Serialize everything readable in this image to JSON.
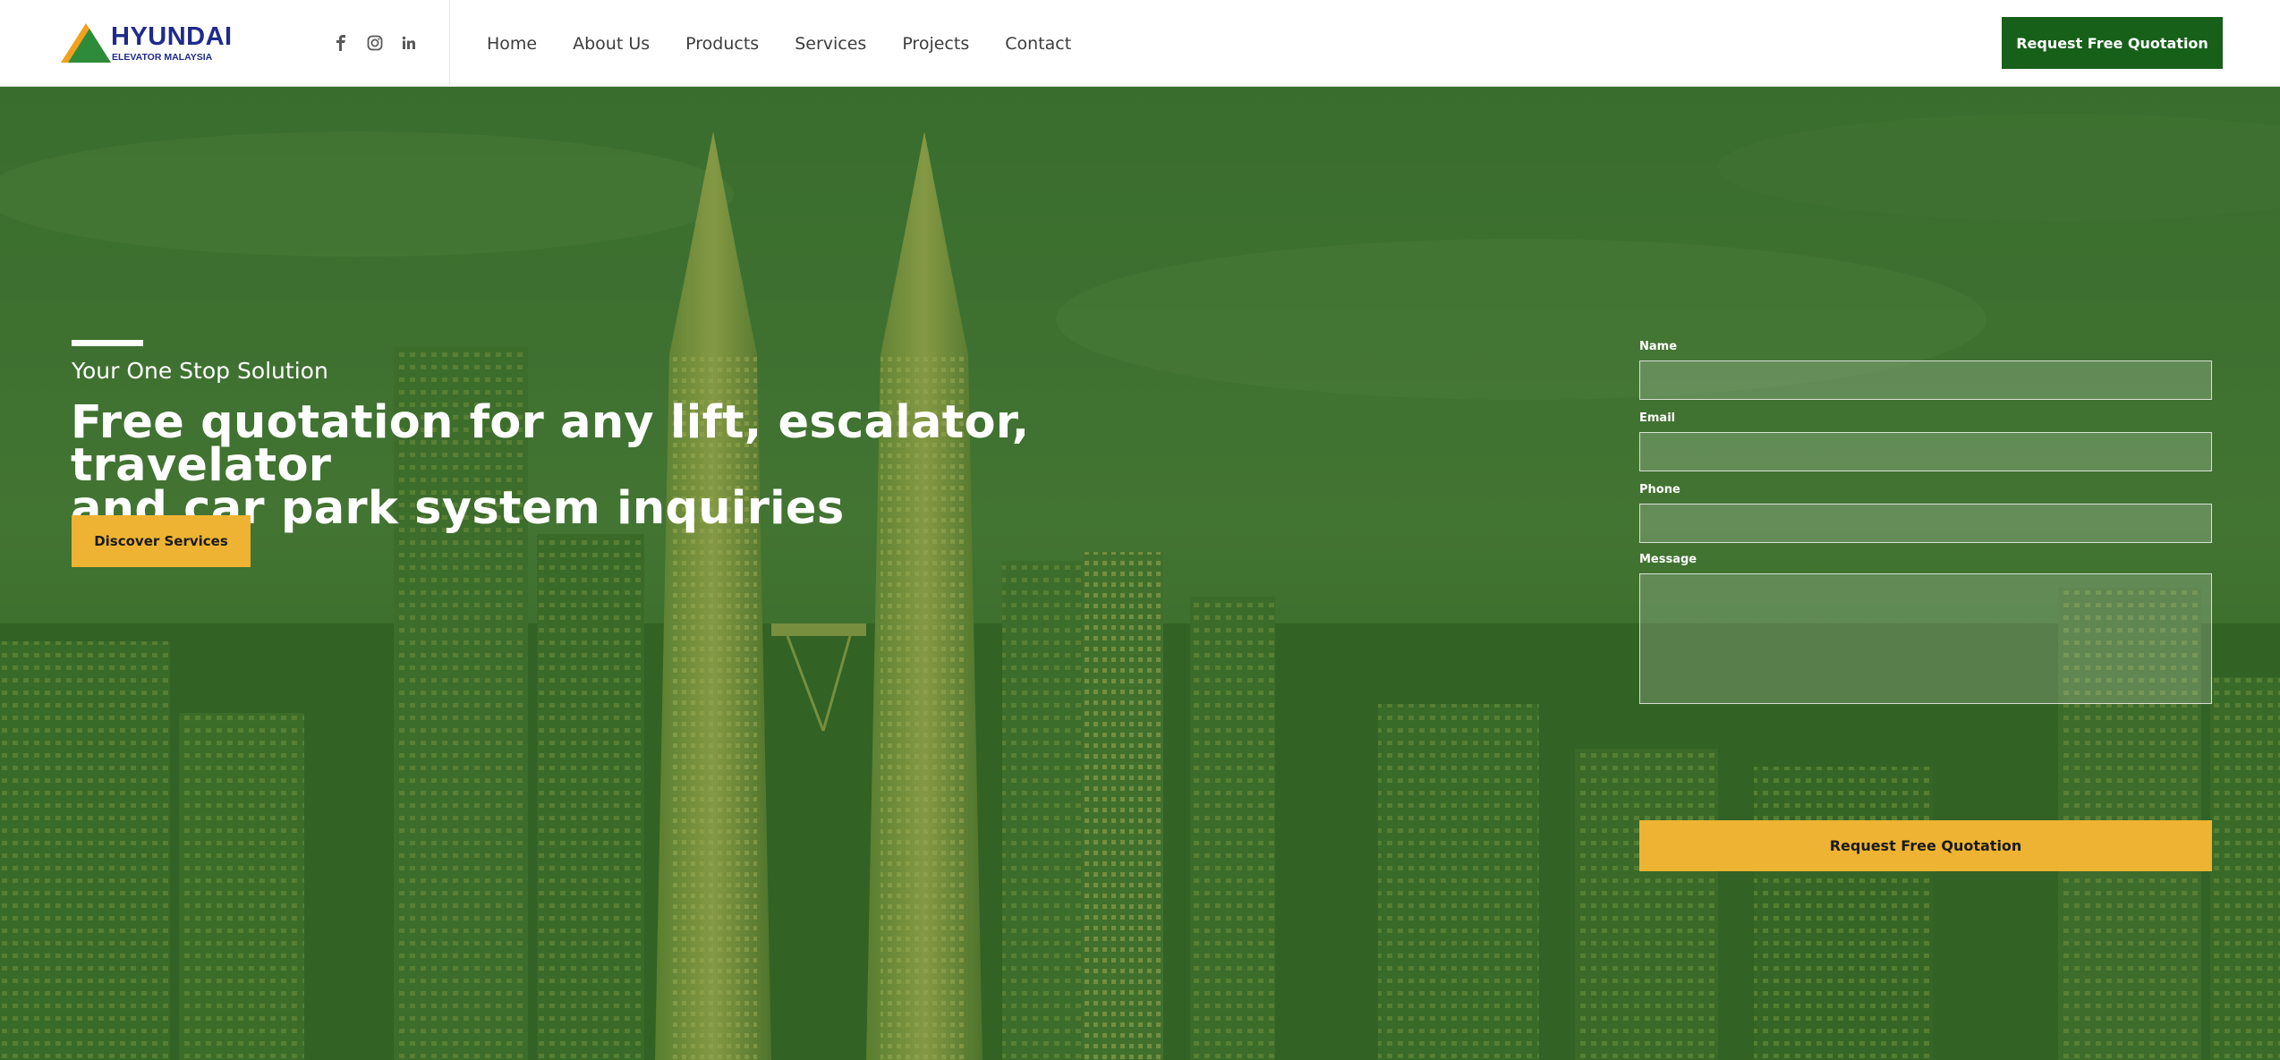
{
  "brand": {
    "name": "HYUNDAI",
    "tagline": "ELEVATOR MALAYSIA",
    "colors": {
      "primary_blue": "#1f2a8c",
      "green": "#2e8b3a",
      "orange": "#f2a11f"
    }
  },
  "header": {
    "socials": [
      {
        "icon": "facebook-icon"
      },
      {
        "icon": "instagram-icon"
      },
      {
        "icon": "linkedin-icon"
      }
    ],
    "nav": [
      "Home",
      "About Us",
      "Products",
      "Services",
      "Projects",
      "Contact"
    ],
    "cta_label": "Request Free Quotation",
    "cta_color": "#17601a"
  },
  "hero": {
    "kicker": "Your One Stop Solution",
    "title_line1": "Free quotation for any lift, escalator, travelator",
    "title_line2": "and car park system inquiries",
    "button_label": "Discover Services",
    "overlay_color": "#2f6b1e",
    "accent_color": "#eeb332"
  },
  "form": {
    "name_label": "Name",
    "email_label": "Email",
    "phone_label": "Phone",
    "message_label": "Message",
    "name_value": "",
    "email_value": "",
    "phone_value": "",
    "message_value": "",
    "submit_label": "Request Free Quotation"
  }
}
